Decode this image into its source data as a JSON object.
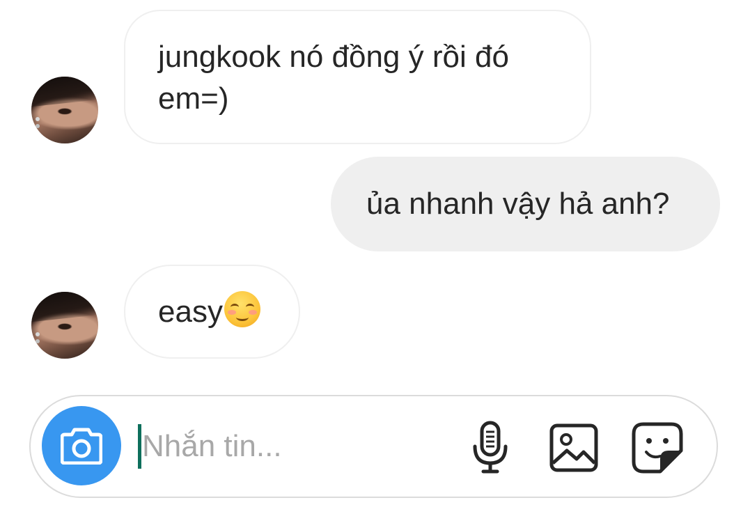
{
  "messages": [
    {
      "direction": "incoming",
      "text_line1": "jungkook nó đồng ý rồi đó",
      "text_line2": "em=)"
    },
    {
      "direction": "outgoing",
      "text": "ủa nhanh vậy hả anh?"
    },
    {
      "direction": "incoming",
      "text": "easy",
      "emoji": "smiling-face-emoji"
    }
  ],
  "composer": {
    "placeholder": "Nhắn tin...",
    "value": "",
    "icons": [
      "camera-icon",
      "microphone-icon",
      "gallery-icon",
      "sticker-icon"
    ]
  },
  "colors": {
    "accent": "#3897f0",
    "outgoing_bubble": "#efefef",
    "incoming_border": "#efefef",
    "text": "#262626",
    "placeholder": "#a8a8a8",
    "caret": "#0e6f5c"
  }
}
